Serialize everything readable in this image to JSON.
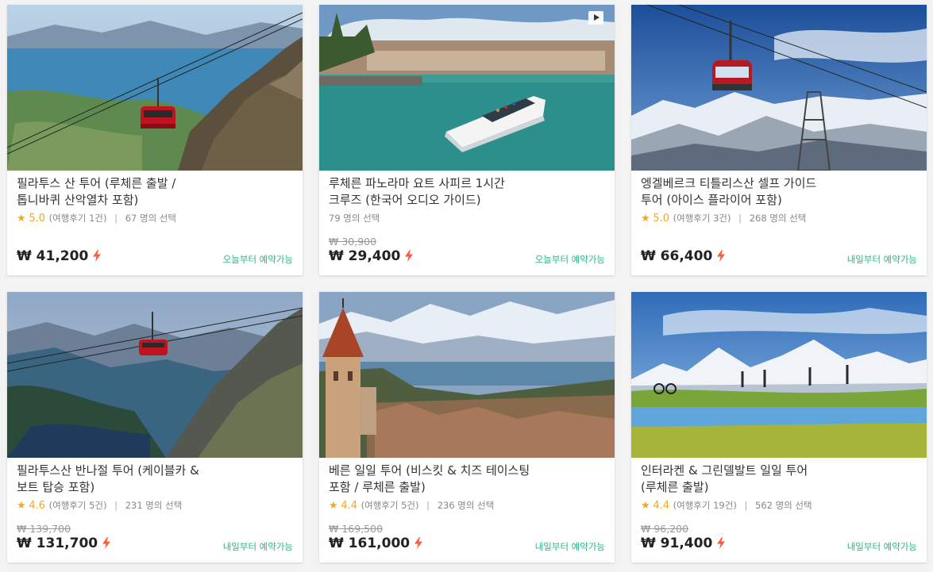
{
  "colors": {
    "rating": "#f5a623",
    "availability": "#2bb58a",
    "price_bolt": "#ff5a3c",
    "background": "#f3f3f3"
  },
  "cards": [
    {
      "title": "필라투스 산 투어 (루체른 출발 /\n톱니바퀴 산악열차 포함)",
      "rating": "5.0",
      "reviews": "(여행후기 1건)",
      "chosen": "67 명의 선택",
      "original_price": "",
      "price": "₩ 41,200",
      "availability": "오늘부터 예약가능",
      "image": "pilatus-cable-car-lake-photo"
    },
    {
      "title": "루체른 파노라마 요트 사피르 1시간\n크루즈 (한국어 오디오 가이드)",
      "rating": "",
      "reviews": "",
      "chosen": "79 명의 선택",
      "original_price": "₩ 30,900",
      "price": "₩ 29,400",
      "availability": "오늘부터 예약가능",
      "image": "lucerne-yacht-photo",
      "video_icon": "play-icon"
    },
    {
      "title": "엥겔베르크 티틀리스산 셀프 가이드\n투어 (아이스 플라이어 포함)",
      "rating": "5.0",
      "reviews": "(여행후기 3건)",
      "chosen": "268 명의 선택",
      "original_price": "",
      "price": "₩ 66,400",
      "availability": "내일부터 예약가능",
      "image": "titlis-rotair-gondola-photo"
    },
    {
      "title": "필라투스산 반나절 투어 (케이블카 &\n보트 탑승 포함)",
      "rating": "4.6",
      "reviews": "(여행후기 5건)",
      "chosen": "231 명의 선택",
      "original_price": "₩ 139,700",
      "price": "₩ 131,700",
      "availability": "내일부터 예약가능",
      "image": "pilatus-half-day-photo"
    },
    {
      "title": "베른 일일 투어 (비스킷 & 치즈 테이스팅\n포함 / 루체른 출발)",
      "rating": "4.4",
      "reviews": "(여행후기 5건)",
      "chosen": "236 명의 선택",
      "original_price": "₩ 169,500",
      "price": "₩ 161,000",
      "availability": "내일부터 예약가능",
      "image": "thun-castle-town-photo"
    },
    {
      "title": "인터라켄 & 그린델발트 일일 투어\n(루체른 출발)",
      "rating": "4.4",
      "reviews": "(여행후기 19건)",
      "chosen": "562 명의 선택",
      "original_price": "₩ 96,200",
      "price": "₩ 91,400",
      "availability": "내일부터 예약가능",
      "image": "grindelwald-hikers-photo"
    }
  ]
}
